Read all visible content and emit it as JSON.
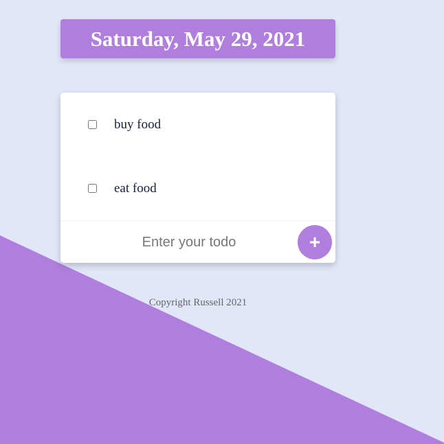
{
  "header": {
    "date": "Saturday, May 29, 2021"
  },
  "todos": [
    {
      "label": "buy food",
      "checked": false
    },
    {
      "label": "eat food",
      "checked": false
    }
  ],
  "form": {
    "placeholder": "Enter your todo",
    "add_label": "+"
  },
  "footer": {
    "text": "Copyright Russell 2021"
  },
  "colors": {
    "accent": "#b07fdd",
    "background": "#e2e6f9"
  }
}
